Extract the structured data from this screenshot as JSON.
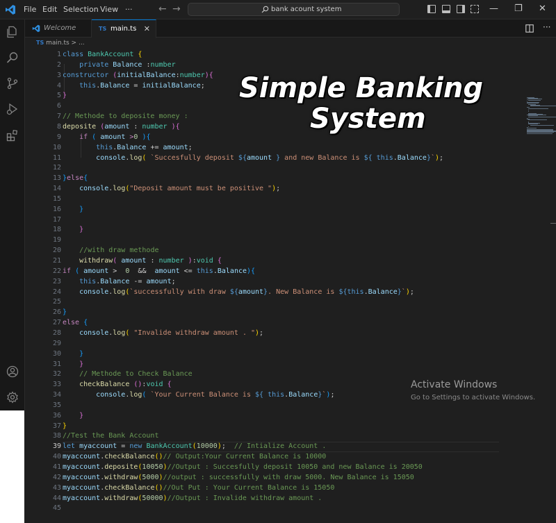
{
  "menu": [
    "File",
    "Edit",
    "Selection",
    "View",
    "···"
  ],
  "search": {
    "text": "bank acount system"
  },
  "tabs": [
    {
      "label": "Welcome"
    },
    {
      "badge": "TS",
      "label": "main.ts"
    }
  ],
  "breadcrumb": {
    "badge": "TS",
    "file": "main.ts",
    "sep": ">",
    "rest": "..."
  },
  "banner": {
    "line1": "Simple Banking",
    "line2": "System"
  },
  "activate": {
    "title": "Activate Windows",
    "sub": "Go to Settings to activate Windows."
  },
  "editor": {
    "active_line": 39
  },
  "code": [
    [
      [
        "kw",
        "class"
      ],
      [
        "t",
        " "
      ],
      [
        "cls",
        "BankAccount"
      ],
      [
        "t",
        " "
      ],
      [
        "br1",
        "{"
      ]
    ],
    [
      [
        "t",
        "    "
      ],
      [
        "kw",
        "private"
      ],
      [
        "t",
        " "
      ],
      [
        "var",
        "Balance"
      ],
      [
        "t",
        " :"
      ],
      [
        "cls",
        "number"
      ]
    ],
    [
      [
        "kw",
        "constructor"
      ],
      [
        "t",
        " "
      ],
      [
        "br2",
        "("
      ],
      [
        "var",
        "initialBalance"
      ],
      [
        "t",
        ":"
      ],
      [
        "cls",
        "number"
      ],
      [
        "br2",
        ")"
      ],
      [
        "br2",
        "{"
      ]
    ],
    [
      [
        "t",
        "    "
      ],
      [
        "kw",
        "this"
      ],
      [
        "t",
        "."
      ],
      [
        "var",
        "Balance"
      ],
      [
        "t",
        " = "
      ],
      [
        "var",
        "initialBalance"
      ],
      [
        "t",
        ";"
      ]
    ],
    [
      [
        "br2",
        "}"
      ]
    ],
    [
      [
        "t",
        ""
      ]
    ],
    [
      [
        "com",
        "// Methode to deposite money :"
      ]
    ],
    [
      [
        "fn",
        "deposite"
      ],
      [
        "t",
        " "
      ],
      [
        "br2",
        "("
      ],
      [
        "var",
        "amount"
      ],
      [
        "t",
        " : "
      ],
      [
        "cls",
        "number"
      ],
      [
        "t",
        " "
      ],
      [
        "br2",
        ")"
      ],
      [
        "br2",
        "{"
      ]
    ],
    [
      [
        "t",
        "    "
      ],
      [
        "ctl",
        "if"
      ],
      [
        "t",
        " "
      ],
      [
        "br3",
        "("
      ],
      [
        "t",
        " "
      ],
      [
        "var",
        "amount"
      ],
      [
        "t",
        " "
      ],
      [
        "ctl",
        ">"
      ],
      [
        "num",
        "0"
      ],
      [
        "t",
        " "
      ],
      [
        "br3",
        ")"
      ],
      [
        "br3",
        "{"
      ]
    ],
    [
      [
        "t",
        "        "
      ],
      [
        "kw",
        "this"
      ],
      [
        "t",
        "."
      ],
      [
        "var",
        "Balance"
      ],
      [
        "t",
        " += "
      ],
      [
        "var",
        "amount"
      ],
      [
        "t",
        ";"
      ]
    ],
    [
      [
        "t",
        "        "
      ],
      [
        "var",
        "console"
      ],
      [
        "t",
        "."
      ],
      [
        "fn",
        "log"
      ],
      [
        "br1",
        "("
      ],
      [
        "t",
        " "
      ],
      [
        "str",
        "`Succesfully deposit "
      ],
      [
        "tmpl",
        "${"
      ],
      [
        "var",
        "amount"
      ],
      [
        "t",
        " "
      ],
      [
        "tmpl",
        "}"
      ],
      [
        "str",
        " and new Balance is "
      ],
      [
        "tmpl",
        "${"
      ],
      [
        "t",
        " "
      ],
      [
        "kw",
        "this"
      ],
      [
        "t",
        "."
      ],
      [
        "var",
        "Balance"
      ],
      [
        "tmpl",
        "}"
      ],
      [
        "str",
        "`"
      ],
      [
        "br1",
        ")"
      ],
      [
        "t",
        ";"
      ]
    ],
    [
      [
        "t",
        ""
      ]
    ],
    [
      [
        "br3",
        "}"
      ],
      [
        "ctl",
        "else"
      ],
      [
        "br3",
        "{"
      ]
    ],
    [
      [
        "t",
        "    "
      ],
      [
        "var",
        "console"
      ],
      [
        "t",
        "."
      ],
      [
        "fn",
        "log"
      ],
      [
        "br1",
        "("
      ],
      [
        "str",
        "\"Deposit amount must be positive \""
      ],
      [
        "br1",
        ")"
      ],
      [
        "t",
        ";"
      ]
    ],
    [
      [
        "t",
        ""
      ]
    ],
    [
      [
        "t",
        "    "
      ],
      [
        "br3",
        "}"
      ]
    ],
    [
      [
        "t",
        ""
      ]
    ],
    [
      [
        "t",
        "    "
      ],
      [
        "br2",
        "}"
      ]
    ],
    [
      [
        "t",
        ""
      ]
    ],
    [
      [
        "t",
        "    "
      ],
      [
        "com",
        "//with draw methode"
      ]
    ],
    [
      [
        "t",
        "    "
      ],
      [
        "fn",
        "withdraw"
      ],
      [
        "br2",
        "("
      ],
      [
        "t",
        " "
      ],
      [
        "var",
        "amount"
      ],
      [
        "t",
        " : "
      ],
      [
        "cls",
        "number"
      ],
      [
        "t",
        " "
      ],
      [
        "br2",
        ")"
      ],
      [
        "t",
        ":"
      ],
      [
        "cls",
        "void"
      ],
      [
        "t",
        " "
      ],
      [
        "br2",
        "{"
      ]
    ],
    [
      [
        "ctl",
        "if"
      ],
      [
        "t",
        " "
      ],
      [
        "br3",
        "("
      ],
      [
        "t",
        " "
      ],
      [
        "var",
        "amount"
      ],
      [
        "t",
        " >  "
      ],
      [
        "num",
        "0"
      ],
      [
        "t",
        "  &&  "
      ],
      [
        "var",
        "amount"
      ],
      [
        "t",
        " <= "
      ],
      [
        "kw",
        "this"
      ],
      [
        "t",
        "."
      ],
      [
        "var",
        "Balance"
      ],
      [
        "br3",
        ")"
      ],
      [
        "br3",
        "{"
      ]
    ],
    [
      [
        "t",
        "    "
      ],
      [
        "kw",
        "this"
      ],
      [
        "t",
        "."
      ],
      [
        "var",
        "Balance"
      ],
      [
        "t",
        " -= "
      ],
      [
        "var",
        "amount"
      ],
      [
        "t",
        ";"
      ]
    ],
    [
      [
        "t",
        "    "
      ],
      [
        "var",
        "console"
      ],
      [
        "t",
        "."
      ],
      [
        "fn",
        "log"
      ],
      [
        "br1",
        "("
      ],
      [
        "str",
        "`successfully with draw "
      ],
      [
        "tmpl",
        "${"
      ],
      [
        "var",
        "amount"
      ],
      [
        "tmpl",
        "}"
      ],
      [
        "str",
        ". New Balance is "
      ],
      [
        "tmpl",
        "${"
      ],
      [
        "kw",
        "this"
      ],
      [
        "t",
        "."
      ],
      [
        "var",
        "Balance"
      ],
      [
        "tmpl",
        "}"
      ],
      [
        "str",
        "`"
      ],
      [
        "br1",
        ")"
      ],
      [
        "t",
        ";"
      ]
    ],
    [
      [
        "t",
        ""
      ]
    ],
    [
      [
        "br3",
        "}"
      ]
    ],
    [
      [
        "ctl",
        "else"
      ],
      [
        "t",
        " "
      ],
      [
        "br3",
        "{"
      ]
    ],
    [
      [
        "t",
        "    "
      ],
      [
        "var",
        "console"
      ],
      [
        "t",
        "."
      ],
      [
        "fn",
        "log"
      ],
      [
        "br1",
        "("
      ],
      [
        "t",
        " "
      ],
      [
        "str",
        "\"Invalide withdraw amount . \""
      ],
      [
        "br1",
        ")"
      ],
      [
        "t",
        ";"
      ]
    ],
    [
      [
        "t",
        ""
      ]
    ],
    [
      [
        "t",
        "    "
      ],
      [
        "br3",
        "}"
      ]
    ],
    [
      [
        "t",
        "    "
      ],
      [
        "br2",
        "}"
      ]
    ],
    [
      [
        "t",
        "    "
      ],
      [
        "com",
        "// Methode to Check Balance"
      ]
    ],
    [
      [
        "t",
        "    "
      ],
      [
        "fn",
        "checkBalance"
      ],
      [
        "t",
        " "
      ],
      [
        "br2",
        "()"
      ],
      [
        "t",
        ":"
      ],
      [
        "cls",
        "void"
      ],
      [
        "t",
        " "
      ],
      [
        "br2",
        "{"
      ]
    ],
    [
      [
        "t",
        "        "
      ],
      [
        "var",
        "console"
      ],
      [
        "t",
        "."
      ],
      [
        "fn",
        "log"
      ],
      [
        "br3",
        "("
      ],
      [
        "t",
        " "
      ],
      [
        "str",
        "`Your Current Balance is "
      ],
      [
        "tmpl",
        "${"
      ],
      [
        "t",
        " "
      ],
      [
        "kw",
        "this"
      ],
      [
        "t",
        "."
      ],
      [
        "var",
        "Balance"
      ],
      [
        "tmpl",
        "}"
      ],
      [
        "str",
        "`"
      ],
      [
        "br3",
        ")"
      ],
      [
        "t",
        ";"
      ]
    ],
    [
      [
        "t",
        ""
      ]
    ],
    [
      [
        "t",
        "    "
      ],
      [
        "br2",
        "}"
      ]
    ],
    [
      [
        "br1",
        "}"
      ]
    ],
    [
      [
        "com",
        "//Test the Bank Account"
      ]
    ],
    [
      [
        "kw",
        "let"
      ],
      [
        "t",
        " "
      ],
      [
        "var",
        "myaccount"
      ],
      [
        "t",
        " = "
      ],
      [
        "kw",
        "new"
      ],
      [
        "t",
        " "
      ],
      [
        "cls",
        "BankAccount"
      ],
      [
        "br1",
        "("
      ],
      [
        "num",
        "10000"
      ],
      [
        "br1",
        ")"
      ],
      [
        "t",
        ";  "
      ],
      [
        "com",
        "// Intialize Account ."
      ]
    ],
    [
      [
        "var",
        "myaccount"
      ],
      [
        "t",
        "."
      ],
      [
        "fn",
        "checkBalance"
      ],
      [
        "br1",
        "()"
      ],
      [
        "com",
        "// Output:Your Current Balance is 10000"
      ]
    ],
    [
      [
        "var",
        "myaccount"
      ],
      [
        "t",
        "."
      ],
      [
        "fn",
        "deposite"
      ],
      [
        "br1",
        "("
      ],
      [
        "num",
        "10050"
      ],
      [
        "br1",
        ")"
      ],
      [
        "com",
        "//Output : Succesfully deposit 10050 and new Balance is 20050"
      ]
    ],
    [
      [
        "var",
        "myaccount"
      ],
      [
        "t",
        "."
      ],
      [
        "fn",
        "withdraw"
      ],
      [
        "br1",
        "("
      ],
      [
        "num",
        "5000"
      ],
      [
        "br1",
        ")"
      ],
      [
        "com",
        "//output : successfully with draw 5000. New Balance is 15050"
      ]
    ],
    [
      [
        "var",
        "myaccount"
      ],
      [
        "t",
        "."
      ],
      [
        "fn",
        "checkBalance"
      ],
      [
        "br1",
        "()"
      ],
      [
        "com",
        "//Out Put : Your Current Balance is 15050"
      ]
    ],
    [
      [
        "var",
        "myaccount"
      ],
      [
        "t",
        "."
      ],
      [
        "fn",
        "withdraw"
      ],
      [
        "br1",
        "("
      ],
      [
        "num",
        "50000"
      ],
      [
        "br1",
        ")"
      ],
      [
        "com",
        "//Output : Invalide withdraw amount ."
      ]
    ],
    [
      [
        "t",
        ""
      ]
    ]
  ]
}
